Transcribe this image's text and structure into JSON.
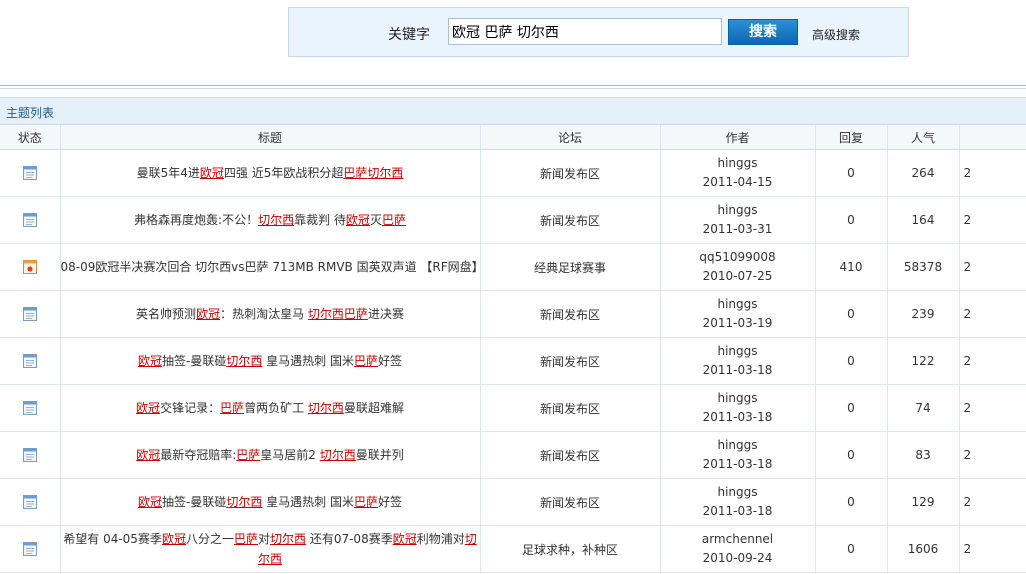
{
  "search": {
    "label": "关键字",
    "value": "欧冠 巴萨 切尔西",
    "button": "搜索",
    "advanced": "高级搜索"
  },
  "list": {
    "title": "主题列表",
    "columns": [
      "状态",
      "标题",
      "论坛",
      "作者",
      "回复",
      "人气",
      ""
    ],
    "rows": [
      {
        "icon": "normal-topic-icon",
        "title": [
          [
            "曼联5年4进",
            0
          ],
          [
            "欧冠",
            1
          ],
          [
            "四强 近5年欧战积分超",
            0
          ],
          [
            "巴萨",
            1
          ],
          [
            "切尔西",
            1
          ]
        ],
        "forum": "新闻发布区",
        "author": "hinggs",
        "date": "2011-04-15",
        "replies": "0",
        "views": "264",
        "last": "2"
      },
      {
        "icon": "normal-topic-icon",
        "title": [
          [
            "弗格森再度炮轰:不公！",
            0
          ],
          [
            "切尔西",
            1
          ],
          [
            "靠裁判 待",
            0
          ],
          [
            "欧冠",
            1
          ],
          [
            "灭",
            0
          ],
          [
            "巴萨",
            1
          ]
        ],
        "forum": "新闻发布区",
        "author": "hinggs",
        "date": "2011-03-31",
        "replies": "0",
        "views": "164",
        "last": "2"
      },
      {
        "icon": "hot-topic-icon",
        "title": [
          [
            "08-09欧冠半决赛次回合 切尔西vs巴萨 713MB RMVB 国英双声道 【RF网盘】",
            0
          ]
        ],
        "forum": "经典足球赛事",
        "author": "qq51099008",
        "date": "2010-07-25",
        "replies": "410",
        "views": "58378",
        "last": "2"
      },
      {
        "icon": "normal-topic-icon",
        "title": [
          [
            "英名帅预测",
            0
          ],
          [
            "欧冠",
            1
          ],
          [
            "：热刺淘汰皇马 ",
            0
          ],
          [
            "切尔西",
            1
          ],
          [
            "巴萨",
            1
          ],
          [
            "进决赛",
            0
          ]
        ],
        "forum": "新闻发布区",
        "author": "hinggs",
        "date": "2011-03-19",
        "replies": "0",
        "views": "239",
        "last": "2"
      },
      {
        "icon": "normal-topic-icon",
        "title": [
          [
            "欧冠",
            1
          ],
          [
            "抽签-曼联碰",
            0
          ],
          [
            "切尔西",
            1
          ],
          [
            " 皇马遇热刺 国米",
            0
          ],
          [
            "巴萨",
            1
          ],
          [
            "好签",
            0
          ]
        ],
        "forum": "新闻发布区",
        "author": "hinggs",
        "date": "2011-03-18",
        "replies": "0",
        "views": "122",
        "last": "2"
      },
      {
        "icon": "normal-topic-icon",
        "title": [
          [
            "欧冠",
            1
          ],
          [
            "交锋记录：",
            0
          ],
          [
            "巴萨",
            1
          ],
          [
            "曾两负矿工 ",
            0
          ],
          [
            "切尔西",
            1
          ],
          [
            "曼联超难解",
            0
          ]
        ],
        "forum": "新闻发布区",
        "author": "hinggs",
        "date": "2011-03-18",
        "replies": "0",
        "views": "74",
        "last": "2"
      },
      {
        "icon": "normal-topic-icon",
        "title": [
          [
            "欧冠",
            1
          ],
          [
            "最新夺冠赔率:",
            0
          ],
          [
            "巴萨",
            1
          ],
          [
            "皇马居前2 ",
            0
          ],
          [
            "切尔西",
            1
          ],
          [
            "曼联并列",
            0
          ]
        ],
        "forum": "新闻发布区",
        "author": "hinggs",
        "date": "2011-03-18",
        "replies": "0",
        "views": "83",
        "last": "2"
      },
      {
        "icon": "normal-topic-icon",
        "title": [
          [
            "欧冠",
            1
          ],
          [
            "抽签-曼联碰",
            0
          ],
          [
            "切尔西",
            1
          ],
          [
            " 皇马遇热刺 国米",
            0
          ],
          [
            "巴萨",
            1
          ],
          [
            "好签",
            0
          ]
        ],
        "forum": "新闻发布区",
        "author": "hinggs",
        "date": "2011-03-18",
        "replies": "0",
        "views": "129",
        "last": "2"
      },
      {
        "icon": "normal-topic-icon",
        "title": [
          [
            "希望有 04-05赛季",
            0
          ],
          [
            "欧冠",
            1
          ],
          [
            "八分之一",
            0
          ],
          [
            "巴萨",
            1
          ],
          [
            "对",
            0
          ],
          [
            "切尔西",
            1
          ],
          [
            " 还有07-08赛季",
            0
          ],
          [
            "欧冠",
            1
          ],
          [
            "利物浦对",
            0
          ],
          [
            "切尔西",
            1
          ]
        ],
        "forum": "足球求种，补种区",
        "author": "armchennel",
        "date": "2010-09-24",
        "replies": "0",
        "views": "1606",
        "last": "2"
      }
    ]
  }
}
